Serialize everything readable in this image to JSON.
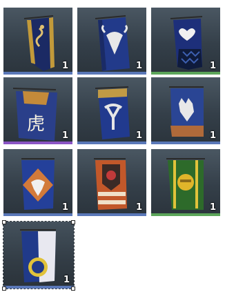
{
  "banners": [
    {
      "quantity": "1",
      "icon": "serpent-banner-icon",
      "rarity": "common"
    },
    {
      "quantity": "1",
      "icon": "bull-skull-banner-icon",
      "rarity": "common"
    },
    {
      "quantity": "1",
      "icon": "heart-crest-banner-icon",
      "rarity": "rare"
    },
    {
      "quantity": "1",
      "icon": "dragon-glyph-banner-icon",
      "rarity": "epic"
    },
    {
      "quantity": "1",
      "icon": "antler-crest-banner-icon",
      "rarity": "common"
    },
    {
      "quantity": "1",
      "icon": "wolf-head-banner-icon",
      "rarity": "common"
    },
    {
      "quantity": "1",
      "icon": "ox-skull-banner-icon",
      "rarity": "common"
    },
    {
      "quantity": "1",
      "icon": "rose-shield-banner-icon",
      "rarity": "epic"
    },
    {
      "quantity": "1",
      "icon": "gold-helm-banner-icon",
      "rarity": "rare"
    },
    {
      "quantity": "1",
      "icon": "white-blue-banner-icon",
      "rarity": "common"
    }
  ]
}
